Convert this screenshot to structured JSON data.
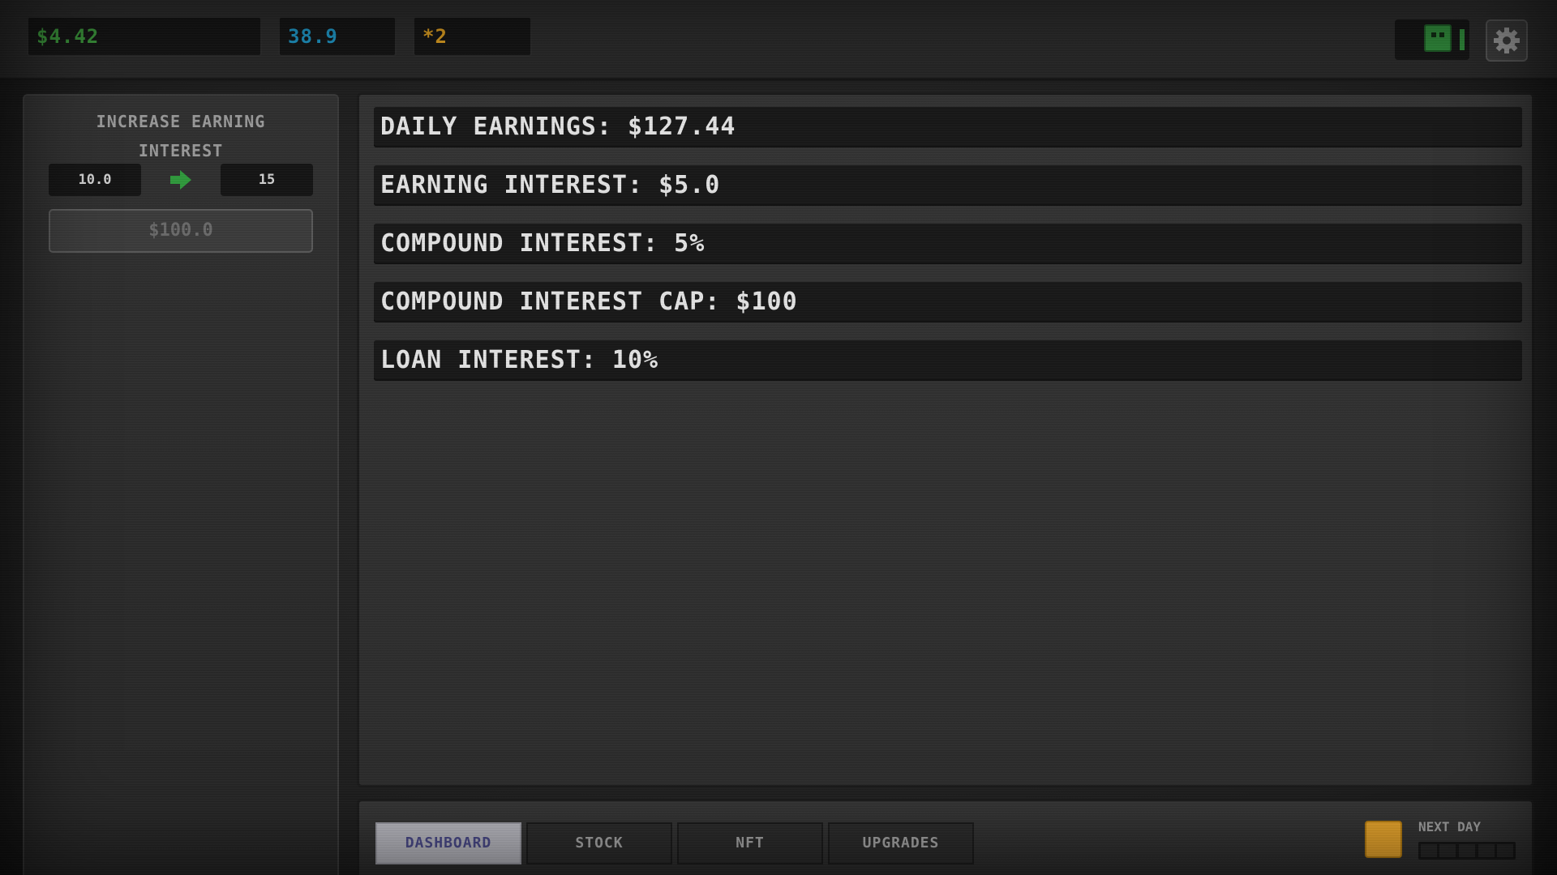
{
  "hud": {
    "money": "$4.42",
    "blue_stat": "38.9",
    "star_stat": "*2",
    "gear_icon": "gear-icon",
    "robot_icon": "robot-icon"
  },
  "upgrade": {
    "title_line1": "INCREASE EARNING",
    "title_line2": "INTEREST",
    "from_value": "10.0",
    "to_value": "15",
    "price": "$100.0",
    "arrow_icon": "arrow-right-icon"
  },
  "stats": [
    "DAILY EARNINGS: $127.44",
    "EARNING INTEREST: $5.0",
    "COMPOUND INTEREST: 5%",
    "COMPOUND INTEREST CAP: $100",
    "LOAN INTEREST: 10%"
  ],
  "tabs": [
    {
      "label": "DASHBOARD",
      "active": true
    },
    {
      "label": "STOCK",
      "active": false
    },
    {
      "label": "NFT",
      "active": false
    },
    {
      "label": "UPGRADES",
      "active": false
    }
  ],
  "next_day": {
    "label": "NEXT DAY",
    "progress_segments": 5,
    "progress_filled": 0
  },
  "colors": {
    "money": "#3c9a3c",
    "blue": "#1e98c8",
    "star": "#e0a020",
    "next_day_swatch": "#e6a32a"
  }
}
